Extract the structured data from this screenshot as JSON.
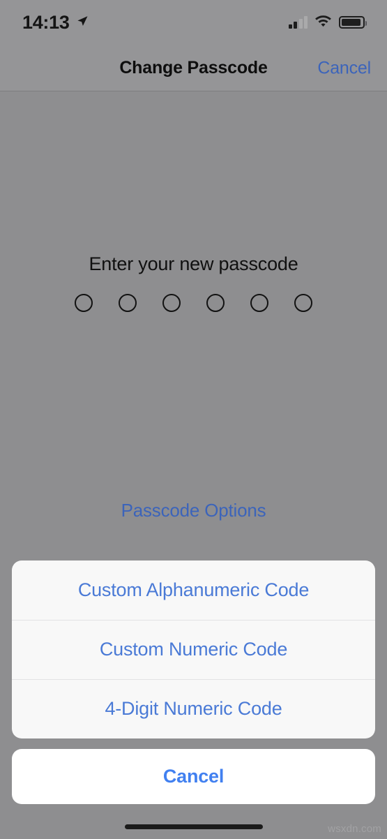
{
  "status_bar": {
    "time": "14:13",
    "location_icon": "location-arrow-icon",
    "cellular_icon": "cellular-signal-icon",
    "wifi_icon": "wifi-icon",
    "battery_icon": "battery-icon"
  },
  "nav_bar": {
    "title": "Change Passcode",
    "cancel_label": "Cancel"
  },
  "main": {
    "prompt": "Enter your new passcode",
    "passcode_length": 6,
    "passcode_filled": 0,
    "passcode_options_label": "Passcode Options"
  },
  "action_sheet": {
    "options": [
      {
        "label": "Custom Alphanumeric Code"
      },
      {
        "label": "Custom Numeric Code"
      },
      {
        "label": "4-Digit Numeric Code"
      }
    ],
    "cancel_label": "Cancel"
  },
  "watermark": "wsxdn.com",
  "colors": {
    "accent_blue": "#4180f0",
    "dimmed_blue": "#4a7ad6",
    "nav_blue": "#3c64ba",
    "backdrop": "#8e8e90",
    "sheet_bg": "#f8f8f8",
    "cancel_bg": "#ffffff"
  }
}
